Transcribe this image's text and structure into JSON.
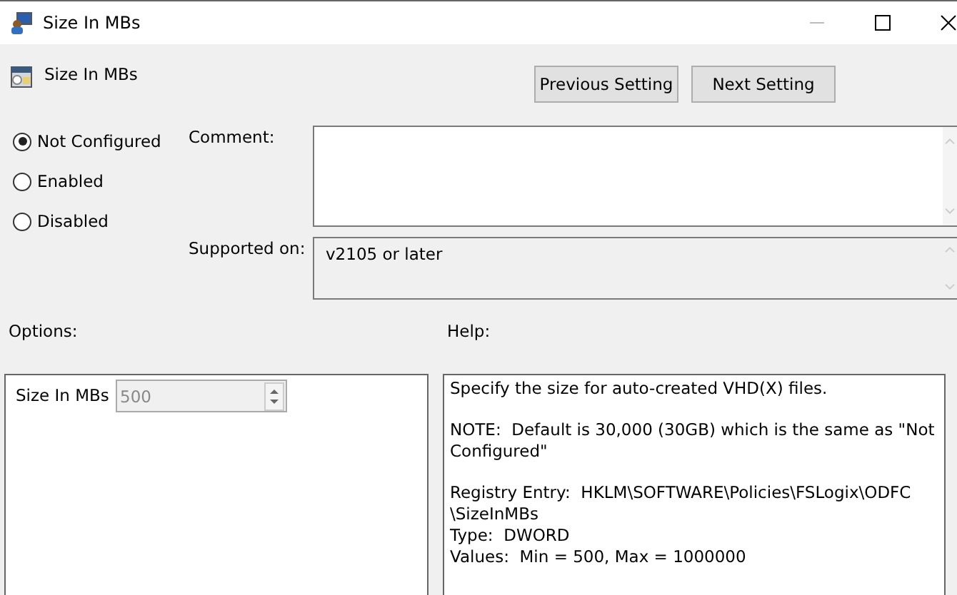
{
  "window": {
    "title": "Size In MBs"
  },
  "header": {
    "title": "Size In MBs"
  },
  "buttons": [
    {
      "label": "Previous Setting"
    },
    {
      "label": "Next Setting"
    }
  ],
  "state_options": [
    {
      "label": "Not Configured",
      "selected": true
    },
    {
      "label": "Enabled",
      "selected": false
    },
    {
      "label": "Disabled",
      "selected": false
    }
  ],
  "comment": {
    "label": "Comment:"
  },
  "supported_on": {
    "label": "Supported on:",
    "value": "v2105 or later"
  },
  "options": {
    "label": "Options:",
    "setting_label": "Size In MBs",
    "value": "500",
    "disabled": true
  },
  "help": {
    "label": "Help:",
    "paragraphs": [
      [
        "Specify the size for auto-created VHD(X) files."
      ],
      [
        "NOTE:  Default is 30,000 (30GB) which is the same as \"Not",
        "Configured\""
      ],
      [
        "Registry Entry:  HKLM\\SOFTWARE\\Policies\\FSLogix\\ODFC",
        "\\SizeInMBs",
        "Type:  DWORD",
        "Values:  Min = 500, Max = 1000000"
      ]
    ]
  }
}
